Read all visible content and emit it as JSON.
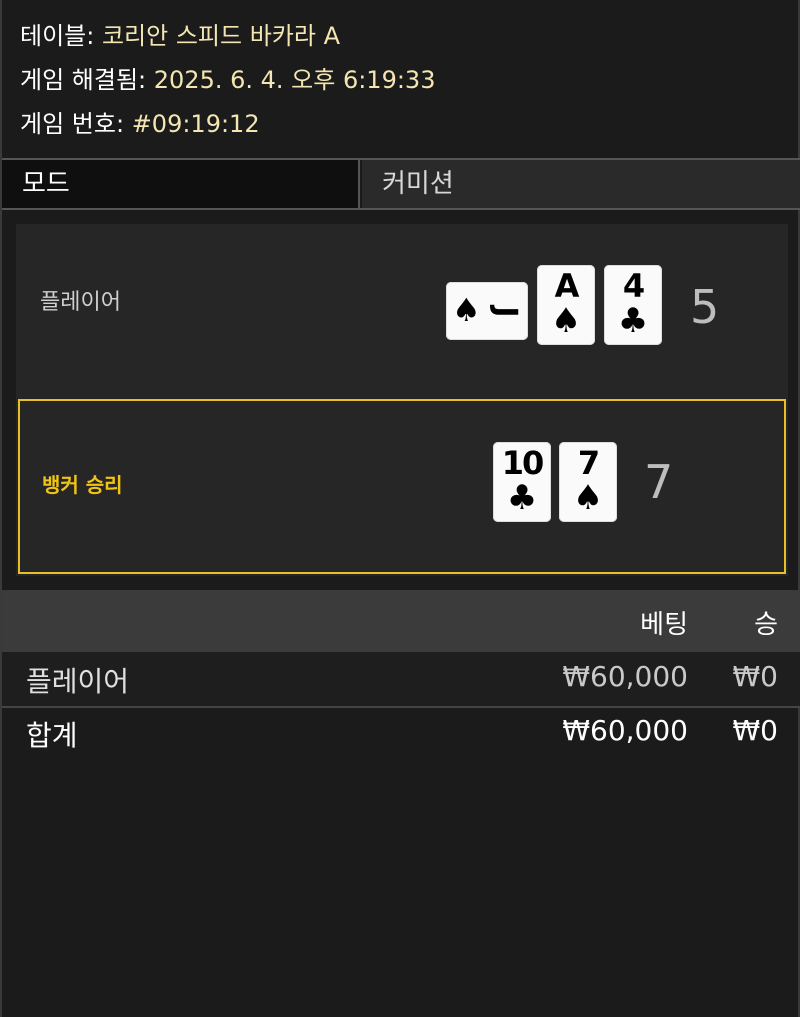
{
  "info": {
    "table_label": "테이블:",
    "table_value": "코리안 스피드 바카라 A",
    "resolved_label": "게임 해결됨:",
    "resolved_value": "2025. 6. 4. 오후 6:19:33",
    "game_no_label": "게임 번호:",
    "game_no_value": "#09:19:12"
  },
  "mode": {
    "label": "모드",
    "value": "커미션"
  },
  "player": {
    "label": "플레이어",
    "score": "5",
    "cards": [
      {
        "rank": "J",
        "suit": "♠",
        "suit_icon": "spade-icon",
        "sideways": true
      },
      {
        "rank": "A",
        "suit": "♠",
        "suit_icon": "spade-icon"
      },
      {
        "rank": "4",
        "suit": "♣",
        "suit_icon": "club-icon"
      }
    ]
  },
  "banker": {
    "label": "뱅커 승리",
    "score": "7",
    "cards": [
      {
        "rank": "10",
        "suit": "♣",
        "suit_icon": "club-icon"
      },
      {
        "rank": "7",
        "suit": "♠",
        "suit_icon": "spade-icon"
      }
    ]
  },
  "bets": {
    "col_bet": "베팅",
    "col_win": "승",
    "rows": [
      {
        "name": "플레이어",
        "bet": "₩60,000",
        "win": "₩0"
      },
      {
        "name": "합계",
        "bet": "₩60,000",
        "win": "₩0"
      }
    ]
  },
  "colors": {
    "highlight": "#f2c514",
    "info_value": "#f3e6b3",
    "background": "#1b1b1b"
  }
}
